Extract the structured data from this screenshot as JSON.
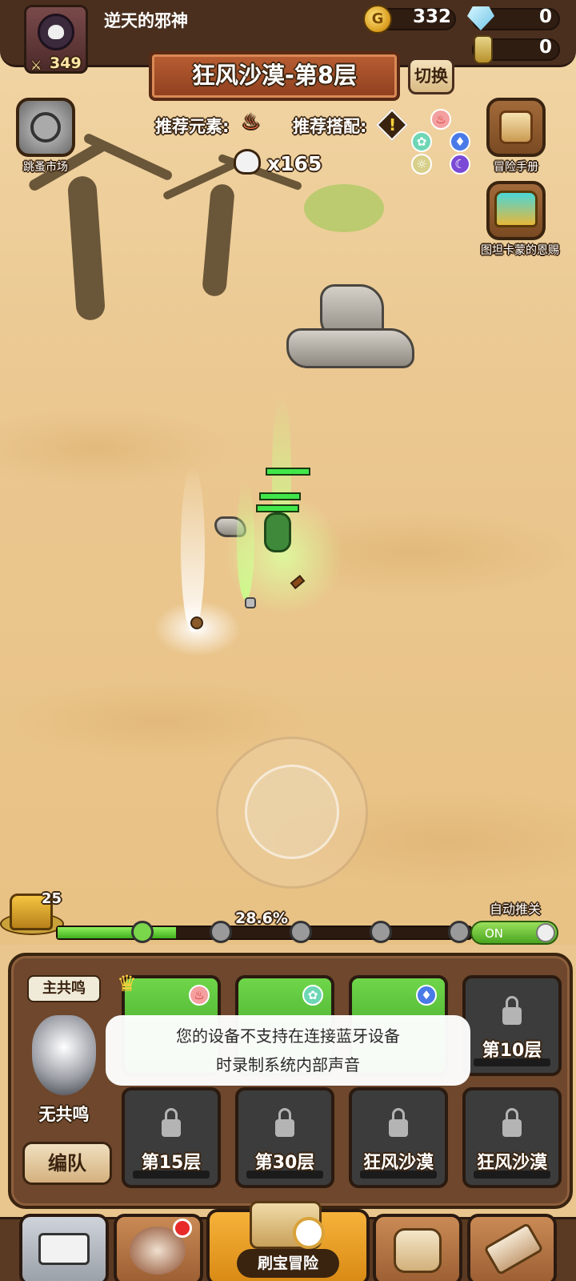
{
  "player": {
    "name": "逆天的邪神",
    "power": "349"
  },
  "currency": {
    "gold": "332",
    "gems": "0",
    "potion": "0"
  },
  "stage": {
    "title": "狂风沙漠-第8层",
    "switch_label": "切换"
  },
  "recommend": {
    "element_label": "推荐元素:",
    "combo_label": "推荐搭配:"
  },
  "kills": "x165",
  "side": {
    "flea_market": "跳蚤市场",
    "adventure_book": "冒险手册",
    "tutankhamun": "图坦卡蒙的恩赐"
  },
  "progress": {
    "percent_text": "28.6%",
    "value": 0.286,
    "chest_count": "25"
  },
  "auto": {
    "label": "自动推关",
    "state": "ON"
  },
  "team": {
    "main_tag": "主共鸣",
    "resonance": "无共鸣",
    "team_button": "编队",
    "slots": [
      {
        "label": "",
        "element": "fire",
        "locked": false
      },
      {
        "label": "",
        "element": "wind",
        "locked": false
      },
      {
        "label": "",
        "element": "water",
        "locked": false
      },
      {
        "label": "第10层",
        "locked": true
      },
      {
        "label": "第15层",
        "locked": true
      },
      {
        "label": "第30层",
        "locked": true
      },
      {
        "label": "狂风沙漠",
        "locked": true
      },
      {
        "label": "狂风沙漠",
        "locked": true
      }
    ]
  },
  "toast": {
    "line1": "您的设备不支持在连接蓝牙设备",
    "line2": "时录制系统内部声音"
  },
  "nav": {
    "active_label": "刷宝冒险"
  },
  "colors": {
    "accent": "#8e3f1f",
    "panel": "#6e472c",
    "progress": "#42b01f",
    "toggle": "#4aa51f"
  }
}
